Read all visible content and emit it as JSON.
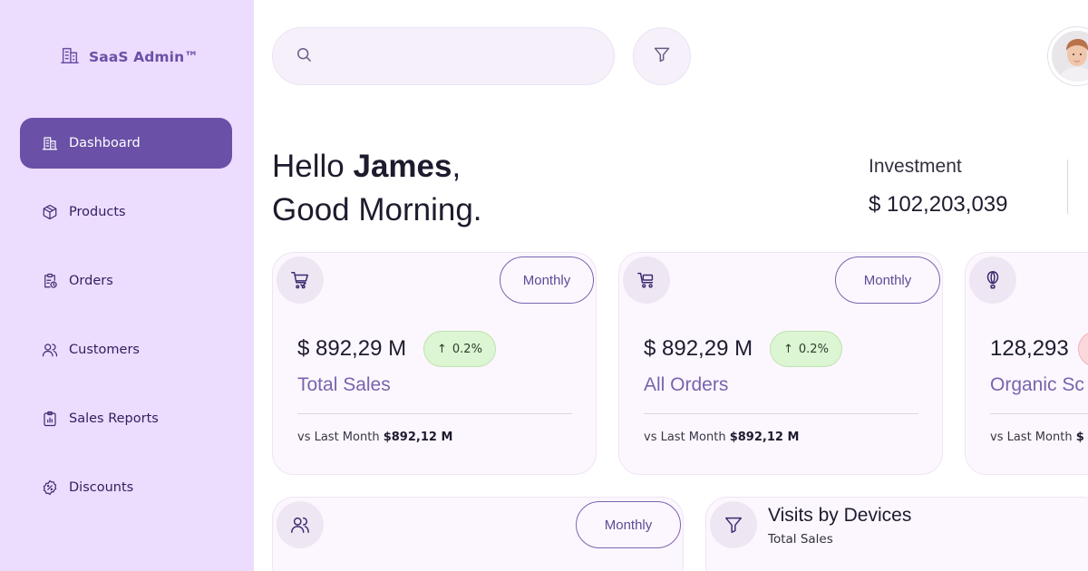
{
  "app": {
    "brand": "SaaS Admin™"
  },
  "sidebar": {
    "items": [
      {
        "label": "Dashboard",
        "icon": "building-icon",
        "active": true
      },
      {
        "label": "Products",
        "icon": "box-icon"
      },
      {
        "label": "Orders",
        "icon": "clipboard-clock-icon"
      },
      {
        "label": "Customers",
        "icon": "users-icon"
      },
      {
        "label": "Sales Reports",
        "icon": "report-icon"
      },
      {
        "label": "Discounts",
        "icon": "discount-badge-icon"
      }
    ]
  },
  "search": {
    "placeholder": "",
    "value": ""
  },
  "greeting": {
    "hello": "Hello",
    "name": "James",
    "comma": ",",
    "line2": "Good Morning."
  },
  "investment": {
    "label": "Investment",
    "value": "$ 102,203,039"
  },
  "cards": [
    {
      "icon": "cart-check-icon",
      "period": "Monthly",
      "amount": "$ 892,29 M",
      "change": "0.2%",
      "change_arrow": "↑",
      "label": "Total Sales",
      "compare_prefix": "vs Last Month",
      "compare_value": "$892,12 M"
    },
    {
      "icon": "trolley-icon",
      "period": "Monthly",
      "amount": "$ 892,29 M",
      "change": "0.2%",
      "change_arrow": "↑",
      "label": "All Orders",
      "compare_prefix": "vs Last Month",
      "compare_value": "$892,12 M"
    },
    {
      "icon": "balloon-icon",
      "period": "",
      "amount": "128,293",
      "change": "",
      "change_arrow": "",
      "label": "Organic Sc",
      "compare_prefix": "vs Last Month",
      "compare_value": "$"
    }
  ],
  "bottom_cards": {
    "customers": {
      "icon": "users-icon",
      "period": "Monthly"
    },
    "visits": {
      "icon": "funnel-icon",
      "title": "Visits by Devices",
      "subtitle": "Total Sales"
    }
  },
  "colors": {
    "sidebar_bg": "#ecdcfe",
    "accent": "#6a50a7",
    "positive_badge": "#dcf5d3",
    "negative_badge": "#fbd8dc",
    "card_bg": "#fcf7fe"
  }
}
